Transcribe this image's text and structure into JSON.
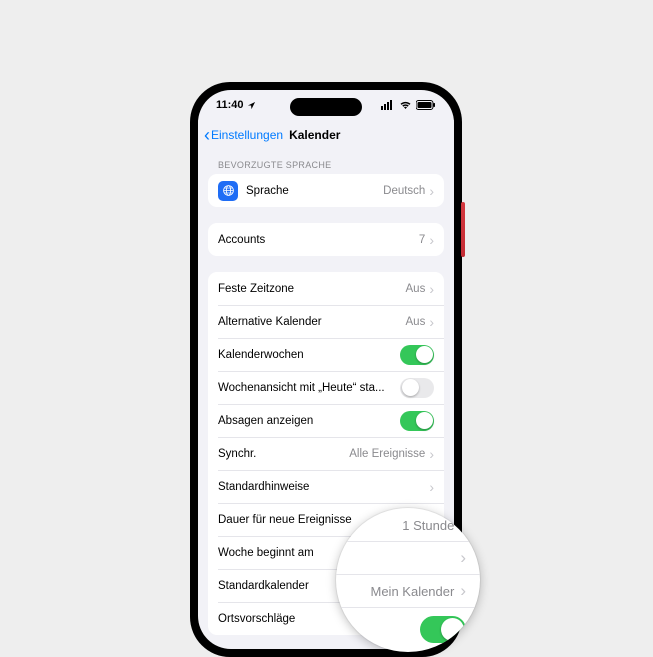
{
  "statusbar": {
    "time": "11:40"
  },
  "nav": {
    "back": "Einstellungen",
    "title": "Kalender"
  },
  "section1_header": "BEVORZUGTE SPRACHE",
  "language_row": {
    "label": "Sprache",
    "value": "Deutsch"
  },
  "accounts_row": {
    "label": "Accounts",
    "value": "7"
  },
  "rows": {
    "fixed_tz": {
      "label": "Feste Zeitzone",
      "value": "Aus"
    },
    "alt_cal": {
      "label": "Alternative Kalender",
      "value": "Aus"
    },
    "week_numbers": {
      "label": "Kalenderwochen"
    },
    "week_today": {
      "label": "Wochenansicht mit „Heute“ sta..."
    },
    "show_declines": {
      "label": "Absagen anzeigen"
    },
    "sync": {
      "label": "Synchr.",
      "value": "Alle Ereignisse"
    },
    "default_alerts": {
      "label": "Standardhinweise"
    },
    "default_duration": {
      "label": "Dauer für neue Ereignisse",
      "value": "1 Stunde"
    },
    "week_start": {
      "label": "Woche beginnt am"
    },
    "default_cal": {
      "label": "Standardkalender",
      "value": "Mein Kalender"
    },
    "location_sugg": {
      "label": "Ortsvorschläge"
    }
  },
  "magnifier": {
    "value_row1": "1 Stunde",
    "value_row3": "Mein Kalender"
  }
}
